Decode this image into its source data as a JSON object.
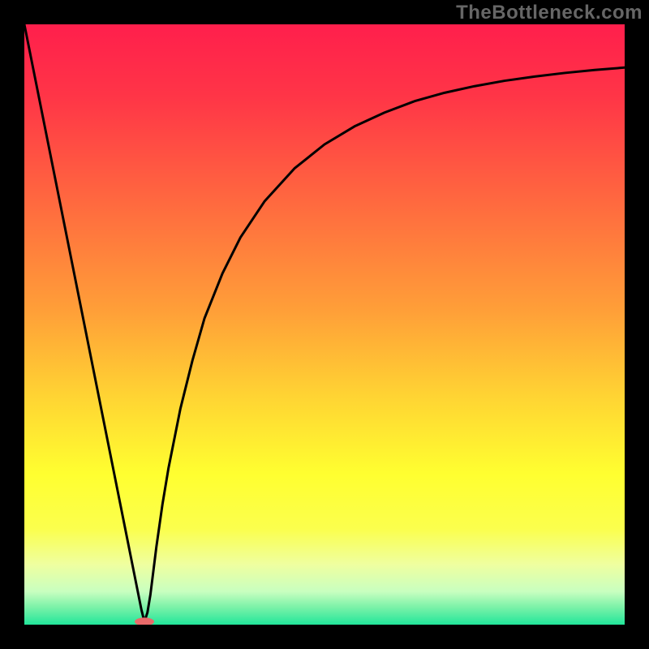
{
  "watermark": "TheBottleneck.com",
  "chart_data": {
    "type": "line",
    "title": "",
    "xlabel": "",
    "ylabel": "",
    "xlim": [
      0,
      100
    ],
    "ylim": [
      0,
      100
    ],
    "grid": false,
    "legend": false,
    "background_gradient": {
      "stops": [
        {
          "offset": 0.0,
          "color": "#ff1f4c"
        },
        {
          "offset": 0.12,
          "color": "#ff3547"
        },
        {
          "offset": 0.3,
          "color": "#ff6a3f"
        },
        {
          "offset": 0.48,
          "color": "#ffa038"
        },
        {
          "offset": 0.62,
          "color": "#ffd433"
        },
        {
          "offset": 0.75,
          "color": "#ffff30"
        },
        {
          "offset": 0.84,
          "color": "#fbff4d"
        },
        {
          "offset": 0.9,
          "color": "#efffa0"
        },
        {
          "offset": 0.945,
          "color": "#c8ffc0"
        },
        {
          "offset": 0.97,
          "color": "#7ef2a9"
        },
        {
          "offset": 1.0,
          "color": "#22e69a"
        }
      ]
    },
    "series": [
      {
        "name": "bottleneck-curve",
        "color": "#000000",
        "x": [
          0,
          2,
          4,
          6,
          8,
          10,
          12,
          14,
          16,
          18,
          19,
          19.5,
          20,
          20.5,
          21,
          21.5,
          22,
          23,
          24,
          26,
          28,
          30,
          33,
          36,
          40,
          45,
          50,
          55,
          60,
          65,
          70,
          75,
          80,
          85,
          90,
          95,
          100
        ],
        "y": [
          100,
          90.0,
          80.0,
          70.0,
          60.0,
          50.0,
          40.0,
          30.0,
          20.0,
          10.0,
          5.0,
          2.5,
          0.5,
          2.0,
          5.0,
          9.0,
          13.0,
          20.0,
          26.0,
          36.0,
          44.0,
          51.0,
          58.5,
          64.5,
          70.5,
          76.0,
          80.0,
          83.0,
          85.3,
          87.2,
          88.6,
          89.7,
          90.6,
          91.3,
          91.9,
          92.4,
          92.8
        ]
      }
    ],
    "marker": {
      "name": "optimal-point",
      "x": 20,
      "y": 0.5,
      "color": "#e96a6a",
      "rx": 12,
      "ry": 5
    }
  }
}
